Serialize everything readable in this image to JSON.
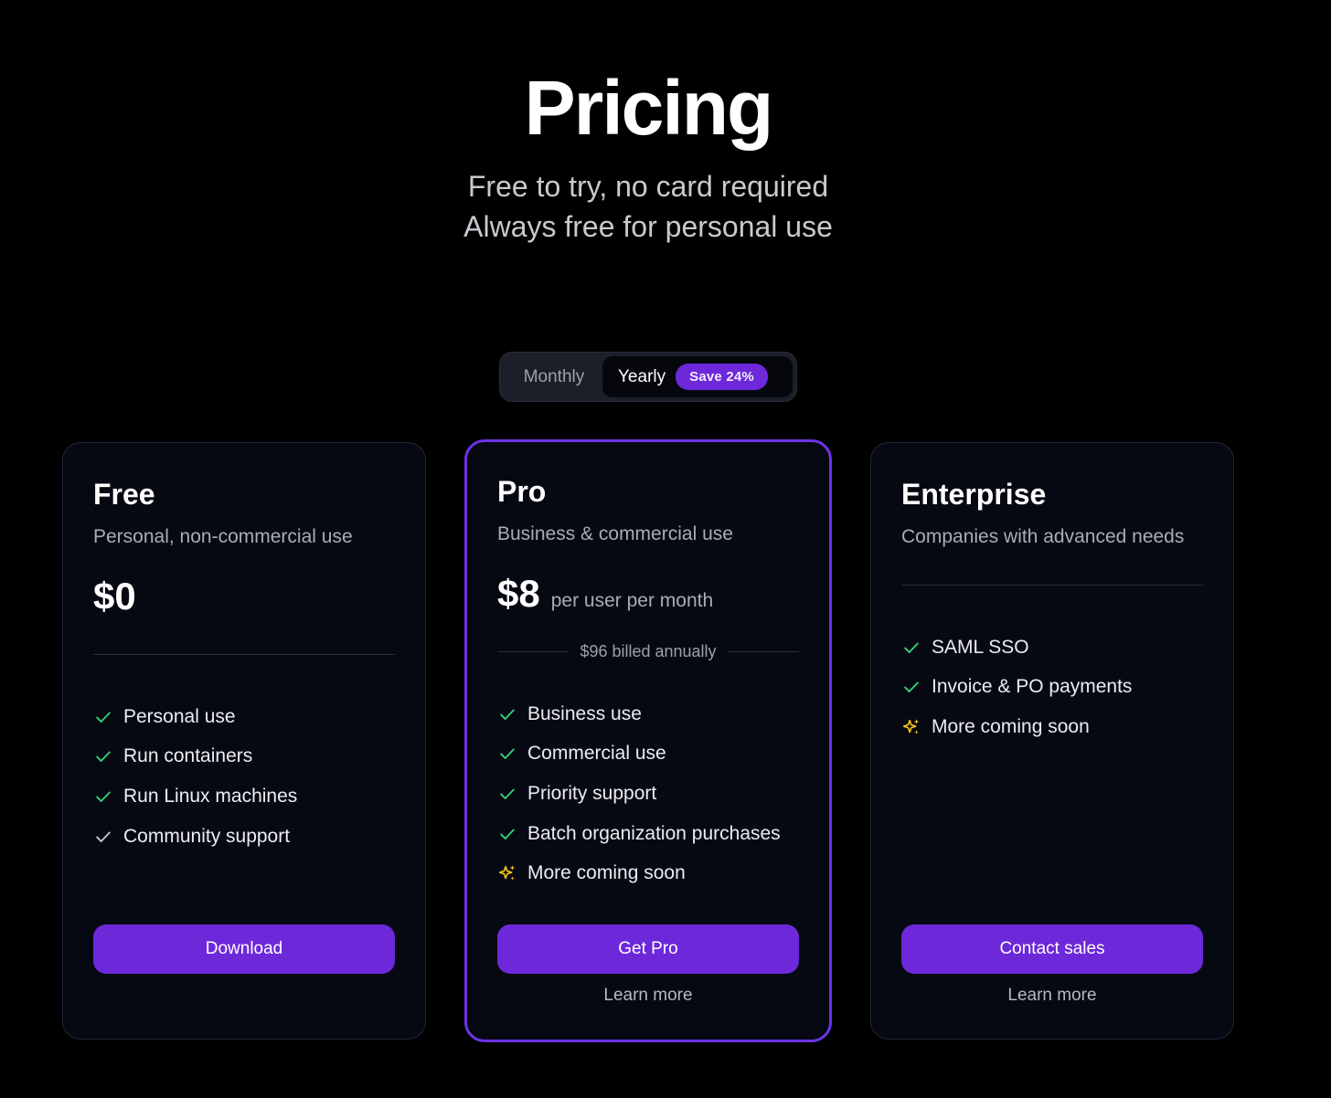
{
  "header": {
    "title": "Pricing",
    "subtitle_line1": "Free to try, no card required",
    "subtitle_line2": "Always free for personal use"
  },
  "billing_toggle": {
    "monthly_label": "Monthly",
    "yearly_label": "Yearly",
    "selected": "Yearly",
    "save_badge": "Save 24%"
  },
  "colors": {
    "accent": "#6d28d9",
    "check_green": "#34d37a",
    "check_gray": "#c9c9cf",
    "sparkle_yellow": "#f5c518"
  },
  "plans": [
    {
      "name": "Free",
      "description": "Personal, non-commercial use",
      "price": "$0",
      "features": [
        {
          "icon": "check-icon",
          "label": "Personal use"
        },
        {
          "icon": "check-icon",
          "label": "Run containers"
        },
        {
          "icon": "check-icon",
          "label": "Run Linux machines"
        },
        {
          "icon": "check-icon",
          "label": "Community support"
        }
      ],
      "cta": "Download"
    },
    {
      "name": "Pro",
      "description": "Business & commercial use",
      "price": "$8",
      "price_unit": "per user per month",
      "billed_note": "$96 billed annually",
      "features": [
        {
          "icon": "check-icon",
          "label": "Business use"
        },
        {
          "icon": "check-icon",
          "label": "Commercial use"
        },
        {
          "icon": "check-icon",
          "label": "Priority support"
        },
        {
          "icon": "check-icon",
          "label": "Batch organization purchases"
        },
        {
          "icon": "sparkle-icon",
          "label": "More coming soon"
        }
      ],
      "cta": "Get Pro",
      "secondary_link": "Learn more"
    },
    {
      "name": "Enterprise",
      "description": "Companies with advanced needs",
      "features": [
        {
          "icon": "check-icon",
          "label": "SAML SSO"
        },
        {
          "icon": "check-icon",
          "label": "Invoice & PO payments"
        },
        {
          "icon": "sparkle-icon",
          "label": "More coming soon"
        }
      ],
      "cta": "Contact sales",
      "secondary_link": "Learn more"
    }
  ]
}
